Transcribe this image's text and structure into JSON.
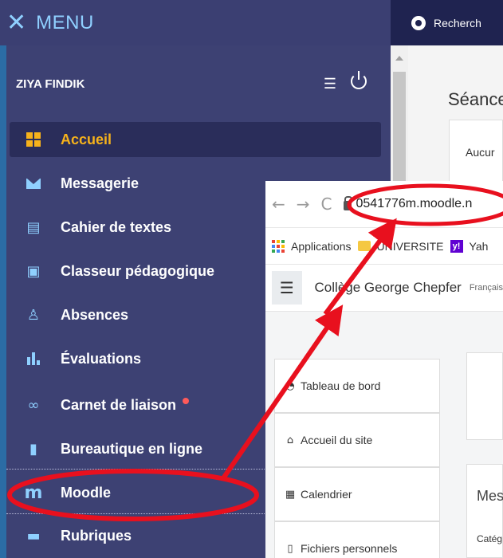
{
  "menu": {
    "close_glyph": "✕",
    "label": "MENU"
  },
  "top_right": {
    "search_text": "Recherch"
  },
  "user": {
    "name": "ZIYA FINDIK"
  },
  "nav": {
    "items": [
      {
        "label": "Accueil",
        "icon": "grid-icon",
        "active": true
      },
      {
        "label": "Messagerie",
        "icon": "envelope-icon"
      },
      {
        "label": "Cahier de textes",
        "icon": "notebook-icon"
      },
      {
        "label": "Classeur pédagogique",
        "icon": "binder-icon"
      },
      {
        "label": "Absences",
        "icon": "absences-icon"
      },
      {
        "label": "Évaluations",
        "icon": "bar-chart-icon"
      },
      {
        "label": "Carnet de liaison",
        "icon": "link-icon",
        "badge_dot": true
      },
      {
        "label": "Bureautique en ligne",
        "icon": "office-icon"
      },
      {
        "label": "Moodle",
        "icon": "moodle-icon",
        "highlighted": true
      },
      {
        "label": "Rubriques",
        "icon": "rubriques-icon"
      }
    ]
  },
  "right_page": {
    "heading": "Séance",
    "box_text": "Aucur"
  },
  "browser": {
    "url": "0541776m.moodle.n",
    "bookmarks": [
      "Applications",
      "UNIVERSITE",
      "Yah"
    ],
    "site_name": "Collège George Chepfer",
    "language": "Français",
    "drawer": [
      "Tableau de bord",
      "Accueil du site",
      "Calendrier",
      "Fichiers personnels"
    ],
    "content_heading": "Mes",
    "content_sub": "Catég"
  },
  "colors": {
    "sidebar_bg": "#3d4173",
    "accent_active": "#f6b21b",
    "icon_blue": "#8fd0ff",
    "annotation_red": "#e8101e"
  }
}
